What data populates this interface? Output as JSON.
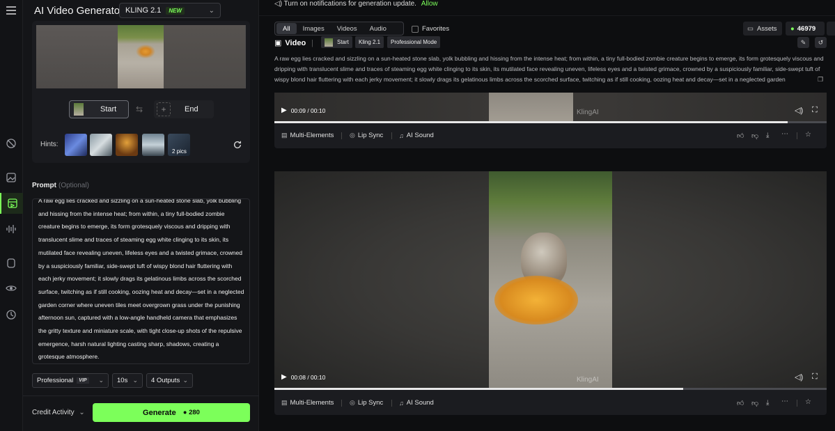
{
  "app": {
    "title": "AI Video Generator",
    "model": "KLING 2.1",
    "model_badge": "NEW"
  },
  "frames": {
    "start_label": "Start",
    "end_label": "End"
  },
  "hints": {
    "label": "Hints:",
    "more_label": "2 pics"
  },
  "prompt": {
    "label": "Prompt",
    "optional": "(Optional)",
    "text": "A raw egg lies cracked and sizzling on a sun-heated stone slab, yolk bubbling and hissing from the intense heat; from within, a tiny full-bodied zombie creature begins to emerge, its form grotesquely viscous and dripping with translucent slime and traces of steaming egg white clinging to its skin, its mutilated face revealing uneven, lifeless eyes and a twisted grimace, crowned by a suspiciously familiar, side-swept tuft of wispy blond hair fluttering with each jerky movement; it slowly drags its gelatinous limbs across the scorched surface, twitching as if still cooking, oozing heat and decay—set in a neglected garden corner where uneven tiles meet overgrown grass under the punishing afternoon sun, captured with a low-angle handheld camera that emphasizes the gritty texture and miniature scale, with tight close-up shots of the repulsive emergence, harsh natural lighting casting sharp, shadows, creating a grotesque atmosphere."
  },
  "settings": {
    "mode": "Professional",
    "mode_badge": "VIP",
    "duration": "10s",
    "outputs": "4 Outputs"
  },
  "footer": {
    "credit_activity": "Credit Activity",
    "generate_label": "Generate",
    "generate_cost": "280"
  },
  "notification": {
    "text": "Turn on notifications for generation update.",
    "allow": "Allow"
  },
  "filter_tabs": [
    "All",
    "Images",
    "Videos",
    "Audio"
  ],
  "favorites_label": "Favorites",
  "assets_label": "Assets",
  "credits_balance": "46979",
  "result": {
    "type_label": "Video",
    "tags": [
      "Start",
      "Kling 2.1",
      "Professional Mode"
    ],
    "description": "A raw egg lies cracked and sizzling on a sun-heated stone slab, yolk bubbling and hissing from the intense heat; from within, a tiny full-bodied zombie creature begins to emerge, its form grotesquely viscous and dripping with translucent slime and traces of steaming egg white clinging to its skin, its mutilated face revealing uneven, lifeless eyes and a twisted grimace, crowned by a suspiciously familiar, side-swept tuft of wispy blond hair fluttering with each jerky movement; it slowly drags its gelatinous limbs across the scorched surface, twitching as if still cooking, oozing heat and decay—set in a neglected garden"
  },
  "videos": [
    {
      "time": "00:09 / 00:10",
      "progress": 0.93,
      "watermark": "KlingAI"
    },
    {
      "time": "00:08 / 00:10",
      "progress": 0.74,
      "watermark": "KlingAI"
    }
  ],
  "actions": {
    "multi_elements": "Multi-Elements",
    "lip_sync": "Lip Sync",
    "ai_sound": "AI Sound"
  },
  "colors": {
    "accent": "#7cff5a",
    "background": "#0d0e10",
    "panel": "#141518"
  }
}
